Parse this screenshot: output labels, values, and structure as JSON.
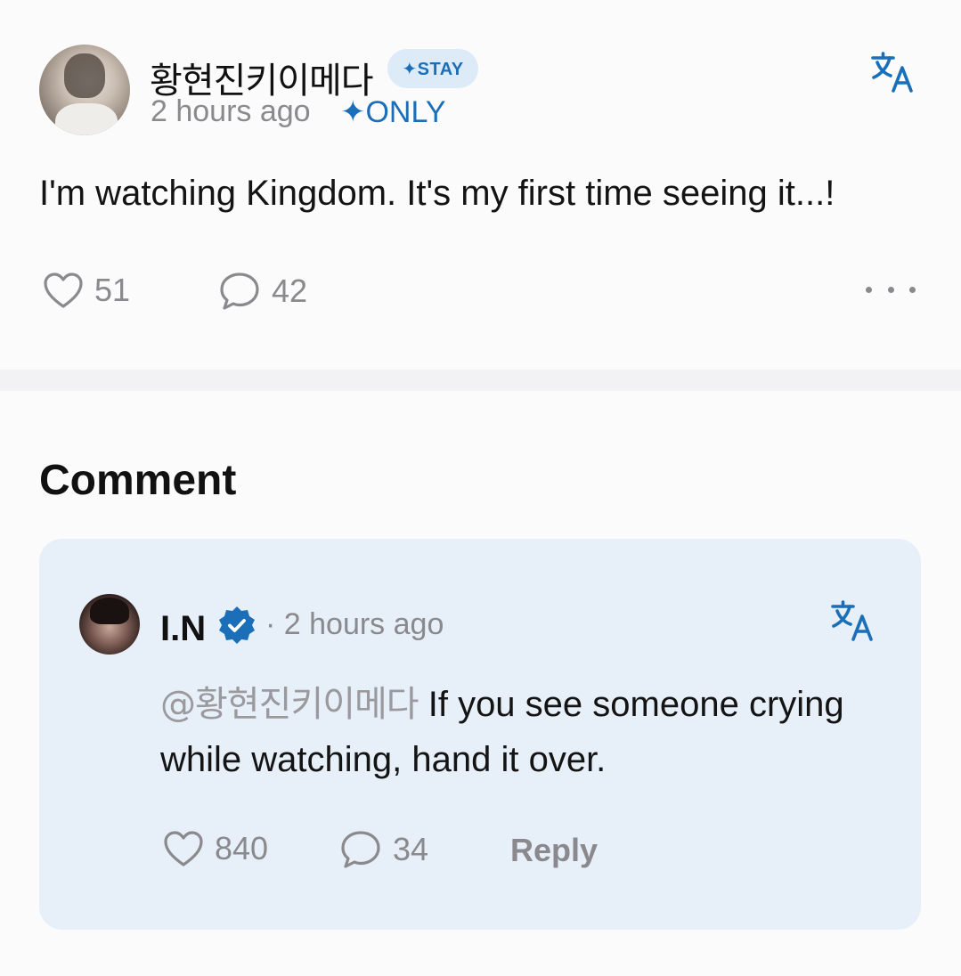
{
  "post": {
    "author": "황현진키이메다",
    "badge": "✦STAY",
    "time": "2 hours ago",
    "audience": "✦ONLY",
    "text": "I'm watching Kingdom. It's my first time seeing it...!",
    "likes": "51",
    "comments": "42",
    "icons": [
      "translate-icon",
      "heart-icon",
      "comment-bubble-icon",
      "more-dots-icon"
    ]
  },
  "comments_section": {
    "heading": "Comment",
    "items": [
      {
        "author": "I.N",
        "verified": true,
        "time": "· 2 hours ago",
        "mention": "@황현진키이메다",
        "text": " If you see someone crying while watching, hand it over.",
        "likes": "840",
        "replies": "34",
        "reply_label": "Reply"
      }
    ]
  },
  "colors": {
    "accent": "#1a6fb8",
    "muted": "#8a8a8e",
    "card_bg": "#e7eff8",
    "badge_bg": "#dcebf7"
  }
}
